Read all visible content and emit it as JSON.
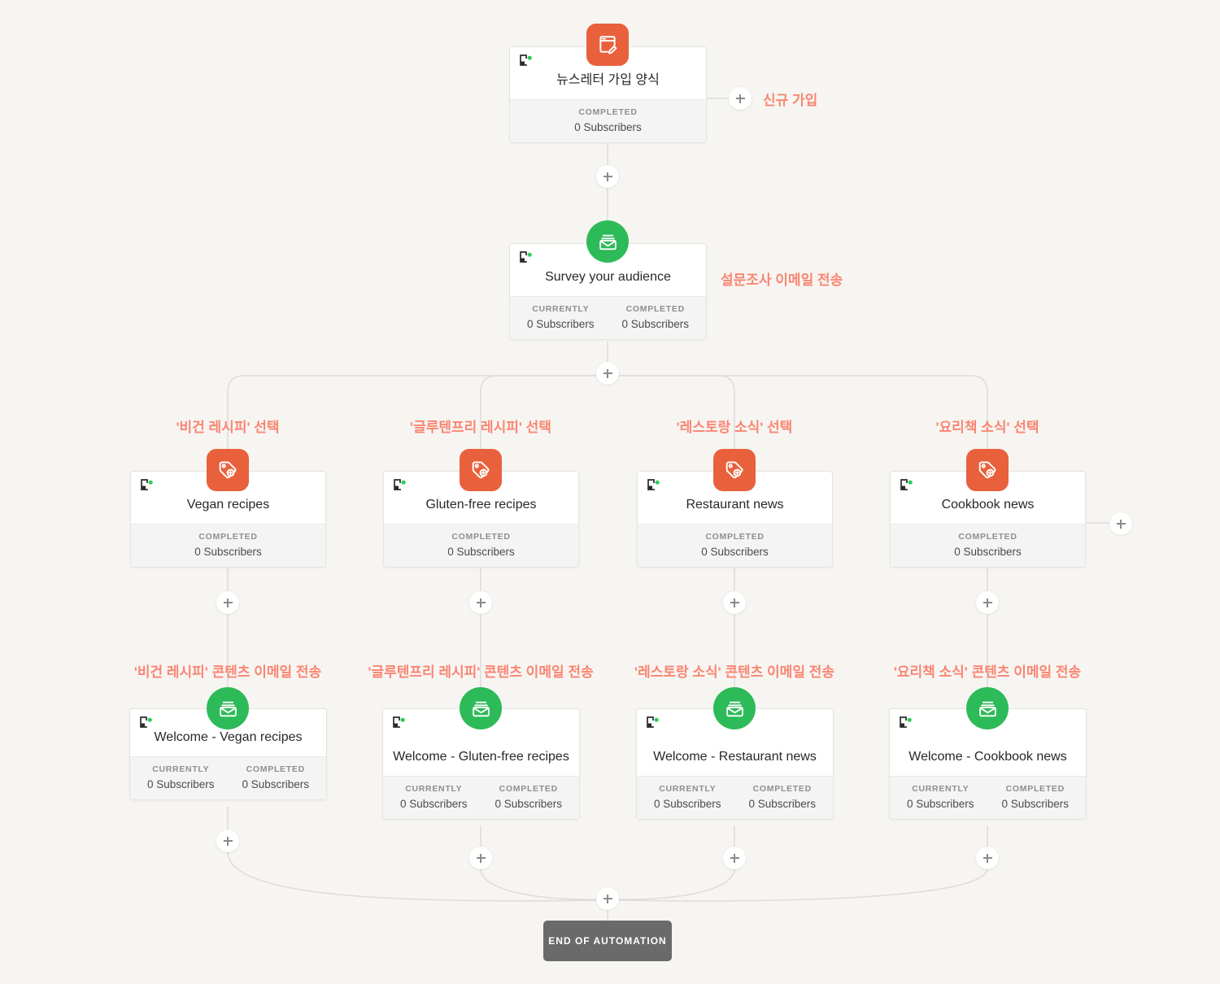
{
  "theme": {
    "background": "#f7f5f1",
    "card_bg": "#ffffff",
    "card_footer_bg": "#f4f4f4",
    "accent_orange": "#e8613c",
    "accent_green": "#2dba58",
    "annotation_color": "#fa8573",
    "wire_color": "#dcdad5",
    "end_pill_bg": "#6a6a6a",
    "status_dot": "#2ecc5a"
  },
  "labels": {
    "currently": "CURRENTLY",
    "completed": "COMPLETED",
    "subscribers_zero": "0 Subscribers",
    "add_step": "+"
  },
  "nodes": [
    {
      "id": "signup-form",
      "title": "뉴스레터 가입 양식",
      "icon": "form-icon",
      "icon_style": "square",
      "stats": [
        {
          "label": "COMPLETED",
          "value": "0 Subscribers"
        }
      ]
    },
    {
      "id": "survey",
      "title": "Survey your audience",
      "icon": "email-icon",
      "icon_style": "circle",
      "stats": [
        {
          "label": "CURRENTLY",
          "value": "0 Subscribers"
        },
        {
          "label": "COMPLETED",
          "value": "0 Subscribers"
        }
      ]
    },
    {
      "id": "tag-vegan",
      "title": "Vegan recipes",
      "icon": "tag-add-icon",
      "icon_style": "square",
      "stats": [
        {
          "label": "COMPLETED",
          "value": "0 Subscribers"
        }
      ]
    },
    {
      "id": "tag-gluten-free",
      "title": "Gluten-free recipes",
      "icon": "tag-add-icon",
      "icon_style": "square",
      "stats": [
        {
          "label": "COMPLETED",
          "value": "0 Subscribers"
        }
      ]
    },
    {
      "id": "tag-restaurant",
      "title": "Restaurant news",
      "icon": "tag-add-icon",
      "icon_style": "square",
      "stats": [
        {
          "label": "COMPLETED",
          "value": "0 Subscribers"
        }
      ]
    },
    {
      "id": "tag-cookbook",
      "title": "Cookbook news",
      "icon": "tag-add-icon",
      "icon_style": "square",
      "stats": [
        {
          "label": "COMPLETED",
          "value": "0 Subscribers"
        }
      ]
    },
    {
      "id": "welcome-vegan",
      "title": "Welcome - Vegan recipes",
      "icon": "email-icon",
      "icon_style": "circle",
      "stats": [
        {
          "label": "CURRENTLY",
          "value": "0 Subscribers"
        },
        {
          "label": "COMPLETED",
          "value": "0 Subscribers"
        }
      ]
    },
    {
      "id": "welcome-gluten-free",
      "title": "Welcome - Gluten-free recipes",
      "icon": "email-icon",
      "icon_style": "circle",
      "stats": [
        {
          "label": "CURRENTLY",
          "value": "0 Subscribers"
        },
        {
          "label": "COMPLETED",
          "value": "0 Subscribers"
        }
      ]
    },
    {
      "id": "welcome-restaurant",
      "title": "Welcome - Restaurant news",
      "icon": "email-icon",
      "icon_style": "circle",
      "stats": [
        {
          "label": "CURRENTLY",
          "value": "0 Subscribers"
        },
        {
          "label": "COMPLETED",
          "value": "0 Subscribers"
        }
      ]
    },
    {
      "id": "welcome-cookbook",
      "title": "Welcome - Cookbook news",
      "icon": "email-icon",
      "icon_style": "circle",
      "stats": [
        {
          "label": "CURRENTLY",
          "value": "0 Subscribers"
        },
        {
          "label": "COMPLETED",
          "value": "0 Subscribers"
        }
      ]
    }
  ],
  "annotations": [
    {
      "id": "a-signup",
      "text": "신규 가입"
    },
    {
      "id": "a-survey",
      "text": "설문조사 이메일 전송"
    },
    {
      "id": "a-tag-vegan",
      "text": "'비건 레시피' 선택"
    },
    {
      "id": "a-tag-gluten",
      "text": "'글루텐프리 레시피' 선택"
    },
    {
      "id": "a-tag-restaurant",
      "text": "'레스토랑 소식' 선택"
    },
    {
      "id": "a-tag-cookbook",
      "text": "'요리책 소식' 선택"
    },
    {
      "id": "a-welcome-vegan",
      "text": "'비건 레시피' 콘텐츠 이메일 전송"
    },
    {
      "id": "a-welcome-gluten",
      "text": "'글루텐프리 레시피' 콘텐츠 이메일 전송"
    },
    {
      "id": "a-welcome-restaurant",
      "text": "'레스토랑 소식' 콘텐츠 이메일 전송"
    },
    {
      "id": "a-welcome-cookbook",
      "text": "'요리책 소식' 콘텐츠 이메일 전송"
    }
  ],
  "end_of_automation": {
    "label": "END OF AUTOMATION"
  }
}
